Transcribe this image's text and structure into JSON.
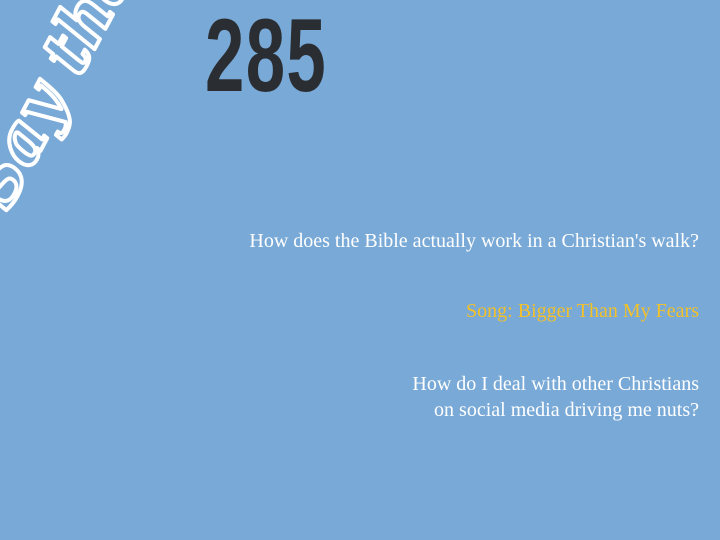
{
  "logo": {
    "text": "Say that!",
    "color": "#ffffff"
  },
  "episode_number": "285",
  "topics": [
    {
      "text": "How does the Bible actually work in a Christian's walk?"
    },
    {
      "text": "Song: Bigger Than My Fears",
      "color": "#f3c12a"
    },
    {
      "lines": [
        "How do I deal with other Christians",
        "on social media driving me nuts?"
      ]
    }
  ],
  "colors": {
    "background": "#79a9d6",
    "number": "#2a2e33",
    "text": "#ffffff",
    "accent": "#f3c12a"
  }
}
